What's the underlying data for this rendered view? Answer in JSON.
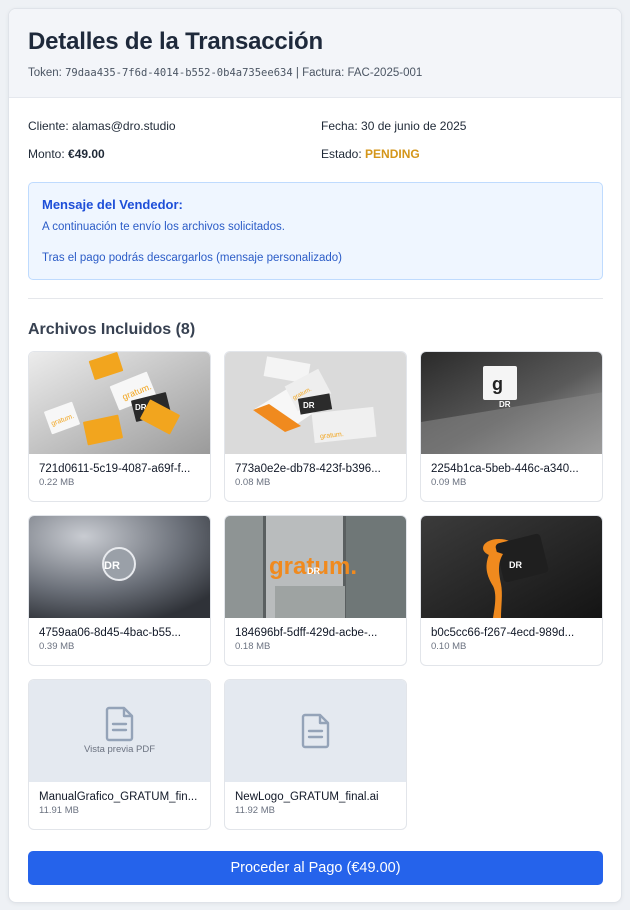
{
  "header": {
    "title": "Detalles de la Transacción",
    "token_label": "Token:",
    "token_value": "79daa435-7f6d-4014-b552-0b4a735ee634",
    "separator": "|",
    "invoice_label": "Factura:",
    "invoice_value": "FAC-2025-001"
  },
  "info": {
    "client_label": "Cliente:",
    "client_value": "alamas@dro.studio",
    "date_label": "Fecha:",
    "date_value": "30 de junio de 2025",
    "amount_label": "Monto:",
    "amount_value": "€49.00",
    "status_label": "Estado:",
    "status_value": "PENDING",
    "status_color": "#d4961a"
  },
  "message": {
    "title": "Mensaje del Vendedor:",
    "line1": "A continuación te envío los archivos solicitados.",
    "line2": "Tras el pago podrás descargarlos (mensaje personalizado)"
  },
  "files": {
    "title": "Archivos Incluidos (8)",
    "items": [
      {
        "name": "721d0611-5c19-4087-a69f-f...",
        "size": "0.22 MB",
        "thumb": "orange-business-cards"
      },
      {
        "name": "773a0e2e-db78-423f-b396...",
        "size": "0.08 MB",
        "thumb": "envelopes"
      },
      {
        "name": "2254b1ca-5beb-446c-a340...",
        "size": "0.09 MB",
        "thumb": "wall-sign"
      },
      {
        "name": "4759aa06-8d45-4bac-b55...",
        "size": "0.39 MB",
        "thumb": "metal-emblem"
      },
      {
        "name": "184696bf-5dff-429d-acbe-...",
        "size": "0.18 MB",
        "thumb": "window-lettering"
      },
      {
        "name": "b0c5cc66-f267-4ecd-989d...",
        "size": "0.10 MB",
        "thumb": "paint-can"
      },
      {
        "name": "ManualGrafico_GRATUM_fin...",
        "size": "11.91 MB",
        "thumb": "document-icon",
        "preview_label": "Vista previa PDF"
      },
      {
        "name": "NewLogo_GRATUM_final.ai",
        "size": "11.92 MB",
        "thumb": "document-icon"
      }
    ]
  },
  "mockup_text": {
    "brand": "gratum.",
    "mark": "DR"
  },
  "pay_button": {
    "label": "Proceder al Pago (€49.00)",
    "color": "#2563eb"
  }
}
